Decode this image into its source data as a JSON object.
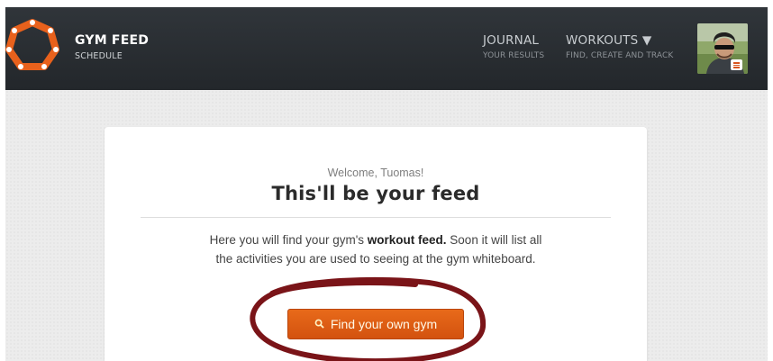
{
  "header": {
    "brand_title": "GYM FEED",
    "brand_subtitle": "SCHEDULE",
    "nav": [
      {
        "label": "JOURNAL",
        "sublabel": "YOUR RESULTS"
      },
      {
        "label": "WORKOUTS ▼",
        "sublabel": "FIND, CREATE AND TRACK"
      }
    ],
    "avatar_icon": "menu-icon"
  },
  "main": {
    "welcome": "Welcome, Tuomas!",
    "title": "This'll be your feed",
    "description_before": "Here you will find your gym's ",
    "description_bold": "workout feed.",
    "description_after": " Soon it will list all the activities you are used to seeing at the gym whiteboard.",
    "find_button_label": "Find your own gym",
    "find_button_icon": "search-icon"
  },
  "colors": {
    "navbar": "#2a2e32",
    "brand_orange": "#e8611c",
    "button_orange": "#d9581a",
    "annotation_red": "#7a1418"
  }
}
